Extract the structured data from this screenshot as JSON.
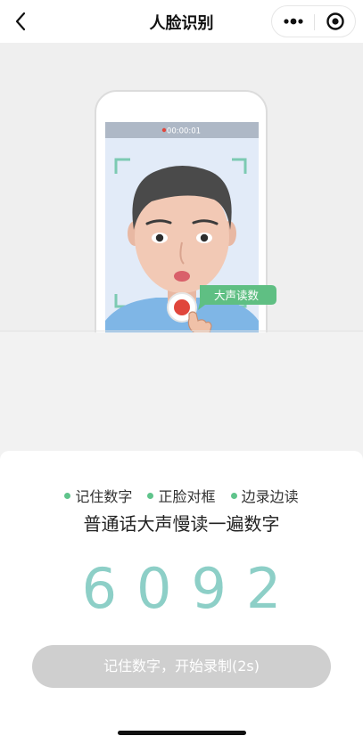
{
  "nav": {
    "title": "人脸识别",
    "back_icon": "chevron-left-icon",
    "more_icon": "more-dots-icon",
    "target_icon": "target-icon"
  },
  "illustration": {
    "timer": "00:00:01",
    "bubble": "大声读数"
  },
  "card": {
    "tips": [
      "记住数字",
      "正脸对框",
      "边录边读"
    ],
    "instruction": "普通话大声慢读一遍数字",
    "digits": "6092",
    "record_button": "记住数字，开始录制(2s)"
  },
  "colors": {
    "accent_green": "#5fc48b",
    "digits_teal": "#8dcfc7",
    "button_disabled": "#cfcfcf"
  }
}
